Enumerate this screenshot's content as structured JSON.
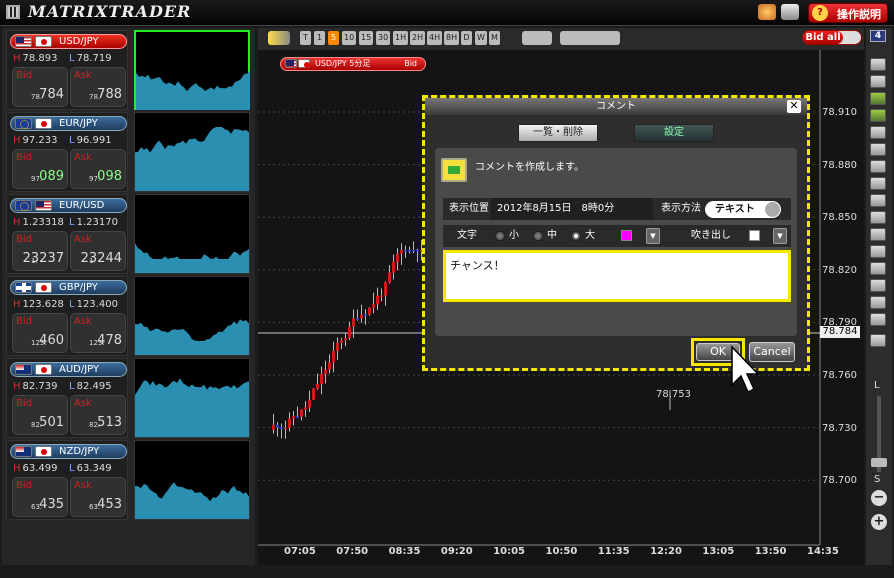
{
  "app": {
    "title": "MATRIXTRADER",
    "help_label": "操作説明"
  },
  "left_panel": {
    "count": "6",
    "pairs": [
      {
        "symbol": "USD/JPY",
        "flags": [
          "us",
          "jp"
        ],
        "high": "78.893",
        "low": "78.719",
        "bid_small": "78.",
        "bid_big": "784",
        "ask_small": "78.",
        "ask_big": "788",
        "selected": true
      },
      {
        "symbol": "EUR/JPY",
        "flags": [
          "eu",
          "jp"
        ],
        "high": "97.233",
        "low": "96.991",
        "bid_small": "97.",
        "bid_big": "089",
        "ask_small": "97.",
        "ask_big": "098",
        "selected": false
      },
      {
        "symbol": "EUR/USD",
        "flags": [
          "eu",
          "us"
        ],
        "high": "1.23318",
        "low": "1.23170",
        "bid_small": "1.",
        "bid_big": "23237",
        "ask_small": "1.",
        "ask_big": "23244",
        "selected": false
      },
      {
        "symbol": "GBP/JPY",
        "flags": [
          "gb",
          "jp"
        ],
        "high": "123.628",
        "low": "123.400",
        "bid_small": "123.",
        "bid_big": "460",
        "ask_small": "123.",
        "ask_big": "478",
        "selected": false
      },
      {
        "symbol": "AUD/JPY",
        "flags": [
          "au",
          "jp"
        ],
        "high": "82.739",
        "low": "82.495",
        "bid_small": "82.",
        "bid_big": "501",
        "ask_small": "82.",
        "ask_big": "513",
        "selected": false
      },
      {
        "symbol": "NZD/JPY",
        "flags": [
          "nz",
          "jp"
        ],
        "high": "63.499",
        "low": "63.349",
        "bid_small": "63.",
        "bid_big": "435",
        "ask_small": "63.",
        "ask_big": "453",
        "selected": false
      }
    ],
    "labels": {
      "high": "H",
      "low": "L",
      "bid": "Bid",
      "ask": "Ask"
    }
  },
  "chart": {
    "timeframes": [
      "T",
      "1",
      "5",
      "10",
      "15",
      "30",
      "1H",
      "2H",
      "4H",
      "8H",
      "D",
      "W",
      "M"
    ],
    "selected_timeframe": "5",
    "bid_toggle_label": "Bid all",
    "tag_label": "USD/JPY 5分足",
    "tag_side": "Bid",
    "y_labels": [
      "78.910",
      "78.880",
      "78.850",
      "78.820",
      "78.790",
      "78.760",
      "78.730",
      "78.700"
    ],
    "x_labels": [
      "07:05",
      "07:50",
      "08:35",
      "09:20",
      "10:05",
      "10:50",
      "11:35",
      "12:20",
      "13:05",
      "13:50",
      "14:35"
    ],
    "current_price": "78.784",
    "low_marker": "78.753",
    "up_color": "#d41818",
    "down_color": "#2a3ad8"
  },
  "right_bar": {
    "count": "4",
    "tools": [
      "info",
      "gear",
      "chart",
      "bell",
      "trendline",
      "pen",
      "line",
      "hline",
      "vline",
      "fib",
      "grid",
      "text",
      "measure",
      "wave",
      "edit",
      "delete",
      "cancel"
    ],
    "zoom_large": "L",
    "zoom_small": "S"
  },
  "dialog": {
    "title": "コメント",
    "list_delete_label": "一覧・削除",
    "settings_label": "設定",
    "message": "コメントを作成します。",
    "position_label": "表示位置",
    "position_value": "2012年8月15日　8時0分",
    "method_label": "表示方法",
    "method_value": "テキスト",
    "text_label": "文字",
    "size_small": "小",
    "size_medium": "中",
    "size_large": "大",
    "selected_size": "大",
    "text_color": "#ff00ff",
    "balloon_label": "吹き出し",
    "balloon_color": "#ffffff",
    "comment_value": "チャンス！",
    "ok_label": "OK",
    "cancel_label": "Cancel"
  }
}
